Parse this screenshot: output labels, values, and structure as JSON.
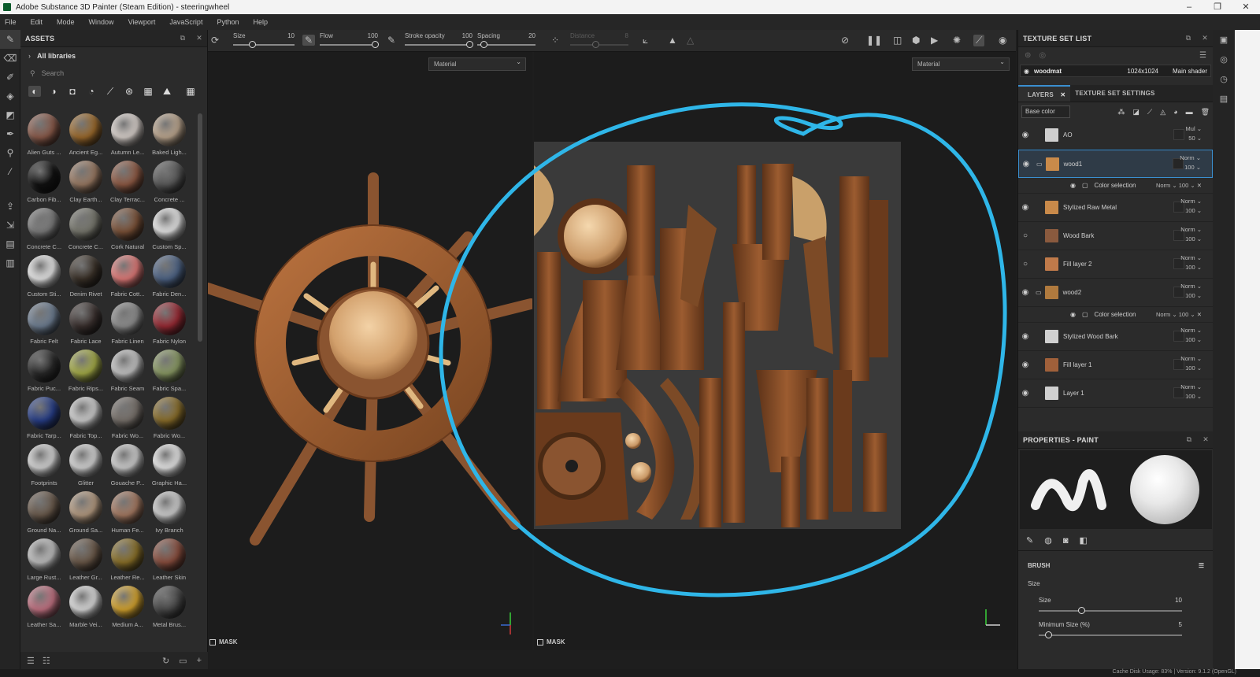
{
  "app": {
    "title": "Adobe Substance 3D Painter (Steam Edition) - steeringwheel",
    "window_buttons": [
      "–",
      "❐",
      "✕"
    ]
  },
  "menu": [
    "File",
    "Edit",
    "Mode",
    "Window",
    "Viewport",
    "JavaScript",
    "Python",
    "Help"
  ],
  "assets": {
    "title": "ASSETS",
    "library": "All libraries",
    "search_placeholder": "Search",
    "items": [
      {
        "label": "Alien Guts ...",
        "color": "#8a5a4a"
      },
      {
        "label": "Ancient Eg...",
        "color": "#9c6a2c"
      },
      {
        "label": "Autumn Le...",
        "color": "#d9d1cc"
      },
      {
        "label": "Baked Ligh...",
        "color": "#bda78f"
      },
      {
        "label": "Carbon Fib...",
        "color": "#121212"
      },
      {
        "label": "Clay Earth...",
        "color": "#9a7a63"
      },
      {
        "label": "Clay Terrac...",
        "color": "#8f5a44"
      },
      {
        "label": "Concrete ...",
        "color": "#5a5a5a"
      },
      {
        "label": "Concrete C...",
        "color": "#7c7c7c"
      },
      {
        "label": "Concrete C...",
        "color": "#77776d"
      },
      {
        "label": "Cork Natural",
        "color": "#7c5238"
      },
      {
        "label": "Custom Sp...",
        "color": "#e8e8e8"
      },
      {
        "label": "Custom Sti...",
        "color": "#e8e8e8"
      },
      {
        "label": "Denim Rivet",
        "color": "#3a3128"
      },
      {
        "label": "Fabric Cott...",
        "color": "#e07a78"
      },
      {
        "label": "Fabric Den...",
        "color": "#4e6486"
      },
      {
        "label": "Fabric Felt",
        "color": "#6e7e92"
      },
      {
        "label": "Fabric Lace",
        "color": "#3a302e"
      },
      {
        "label": "Fabric Linen",
        "color": "#8e8e8e"
      },
      {
        "label": "Fabric Nylon",
        "color": "#9a2a34"
      },
      {
        "label": "Fabric Puc...",
        "color": "#2a2a2a"
      },
      {
        "label": "Fabric Rips...",
        "color": "#a6ad48"
      },
      {
        "label": "Fabric Seam",
        "color": "#c5c5c5"
      },
      {
        "label": "Fabric Spa...",
        "color": "#8a9a64"
      },
      {
        "label": "Fabric Tarp...",
        "color": "#273e88"
      },
      {
        "label": "Fabric Top...",
        "color": "#cfcfcf"
      },
      {
        "label": "Fabric Wo...",
        "color": "#77706a"
      },
      {
        "label": "Fabric Wo...",
        "color": "#8a6e2a"
      },
      {
        "label": "Footprints",
        "color": "#d5d5d5"
      },
      {
        "label": "Glitter",
        "color": "#d5d5d5"
      },
      {
        "label": "Gouache P...",
        "color": "#cfcfcf"
      },
      {
        "label": "Graphic Ha...",
        "color": "#e8e8e8"
      },
      {
        "label": "Ground Na...",
        "color": "#6a5a4c"
      },
      {
        "label": "Ground Sa...",
        "color": "#b49a80"
      },
      {
        "label": "Human Fe...",
        "color": "#a67a62"
      },
      {
        "label": "Ivy Branch",
        "color": "#d0d0d0"
      },
      {
        "label": "Large Rust...",
        "color": "#c0c0c0"
      },
      {
        "label": "Leather Gr...",
        "color": "#6a5848"
      },
      {
        "label": "Leather Re...",
        "color": "#8a7028"
      },
      {
        "label": "Leather Skin",
        "color": "#8a4e3e"
      },
      {
        "label": "Leather Sa...",
        "color": "#c27282"
      },
      {
        "label": "Marble Vei...",
        "color": "#dcdcdc"
      },
      {
        "label": "Medium A...",
        "color": "#d5a42e"
      },
      {
        "label": "Metal Brus...",
        "color": "#4a4a4a"
      }
    ]
  },
  "toolbar": {
    "size_label": "Size",
    "size_value": "10",
    "flow_label": "Flow",
    "flow_value": "100",
    "stroke_label": "Stroke opacity",
    "stroke_value": "100",
    "spacing_label": "Spacing",
    "spacing_value": "20",
    "distance_label": "Distance",
    "distance_value": "8"
  },
  "viewports": {
    "left_channel": "Material",
    "right_channel": "Material",
    "mask_label": "MASK"
  },
  "texture_set_list": {
    "title": "TEXTURE SET LIST",
    "name": "woodmat",
    "resolution": "1024x1024",
    "shader": "Main shader"
  },
  "layers": {
    "tab_layers": "LAYERS",
    "tab_settings": "TEXTURE SET SETTINGS",
    "channel": "Base color",
    "rows": [
      {
        "name": "AO",
        "blend": "Mul",
        "opacity": "50",
        "thumb": "#cfcfcf"
      },
      {
        "name": "wood1",
        "blend": "Norm",
        "opacity": "100",
        "thumb": "#c98a4a"
      },
      {
        "name": "Stylized Raw Metal",
        "blend": "Norm",
        "opacity": "100",
        "thumb": "#c98a4a"
      },
      {
        "name": "Wood Bark",
        "blend": "Norm",
        "opacity": "100",
        "thumb": "#8a5a3e"
      },
      {
        "name": "Fill layer 2",
        "blend": "Norm",
        "opacity": "100",
        "thumb": "#c07a4a"
      },
      {
        "name": "wood2",
        "blend": "Norm",
        "opacity": "100",
        "thumb": "#b07a3e"
      },
      {
        "name": "Stylized Wood Bark",
        "blend": "Norm",
        "opacity": "100",
        "thumb": "#d0d0d0"
      },
      {
        "name": "Fill layer 1",
        "blend": "Norm",
        "opacity": "100",
        "thumb": "#a0603a"
      },
      {
        "name": "Layer 1",
        "blend": "Norm",
        "opacity": "100",
        "thumb": "#d0d0d0"
      }
    ],
    "sub": {
      "name": "Color selection",
      "blend": "Norm",
      "opacity": "100"
    }
  },
  "properties": {
    "title": "PROPERTIES - PAINT",
    "brush_title": "BRUSH",
    "size_section": "Size",
    "size_label": "Size",
    "size_value": "10",
    "min_size_label": "Minimum Size (%)",
    "min_size_value": "5"
  },
  "status": "Cache Disk Usage:  83% | Version: 9.1.2 (OpenGL)",
  "colors": {
    "annotation": "#2fb6e8",
    "accent": "#3a8fd0"
  }
}
